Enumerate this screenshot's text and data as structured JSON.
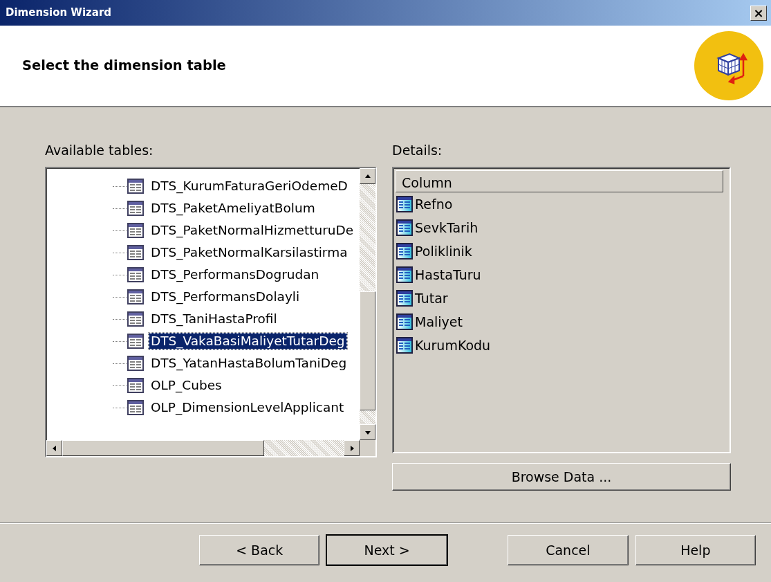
{
  "window": {
    "title": "Dimension Wizard",
    "close_label": "×"
  },
  "header": {
    "title": "Select the dimension table"
  },
  "available_tables": {
    "label": "Available tables:",
    "items": [
      {
        "name": "DTS_KurumFaturaGeriOdemeD",
        "selected": false
      },
      {
        "name": "DTS_PaketAmeliyatBolum",
        "selected": false
      },
      {
        "name": "DTS_PaketNormalHizmetturuDe",
        "selected": false
      },
      {
        "name": "DTS_PaketNormalKarsilastirma",
        "selected": false
      },
      {
        "name": "DTS_PerformansDogrudan",
        "selected": false
      },
      {
        "name": "DTS_PerformansDolayli",
        "selected": false
      },
      {
        "name": "DTS_TaniHastaProfil",
        "selected": false
      },
      {
        "name": "DTS_VakaBasiMaliyetTutarDeg",
        "selected": true
      },
      {
        "name": "DTS_YatanHastaBolumTaniDeg",
        "selected": false
      },
      {
        "name": "OLP_Cubes",
        "selected": false
      },
      {
        "name": "OLP_DimensionLevelApplicant",
        "selected": false
      }
    ]
  },
  "details": {
    "label": "Details:",
    "column_header": "Column",
    "columns": [
      "Refno",
      "SevkTarih",
      "Poliklinik",
      "HastaTuru",
      "Tutar",
      "Maliyet",
      "KurumKodu"
    ],
    "browse_button": "Browse Data ..."
  },
  "buttons": [
    {
      "label": "< Back",
      "default": false
    },
    {
      "label": "Next >",
      "default": true
    },
    {
      "label": "Cancel",
      "default": false
    },
    {
      "label": "Help",
      "default": false
    }
  ]
}
